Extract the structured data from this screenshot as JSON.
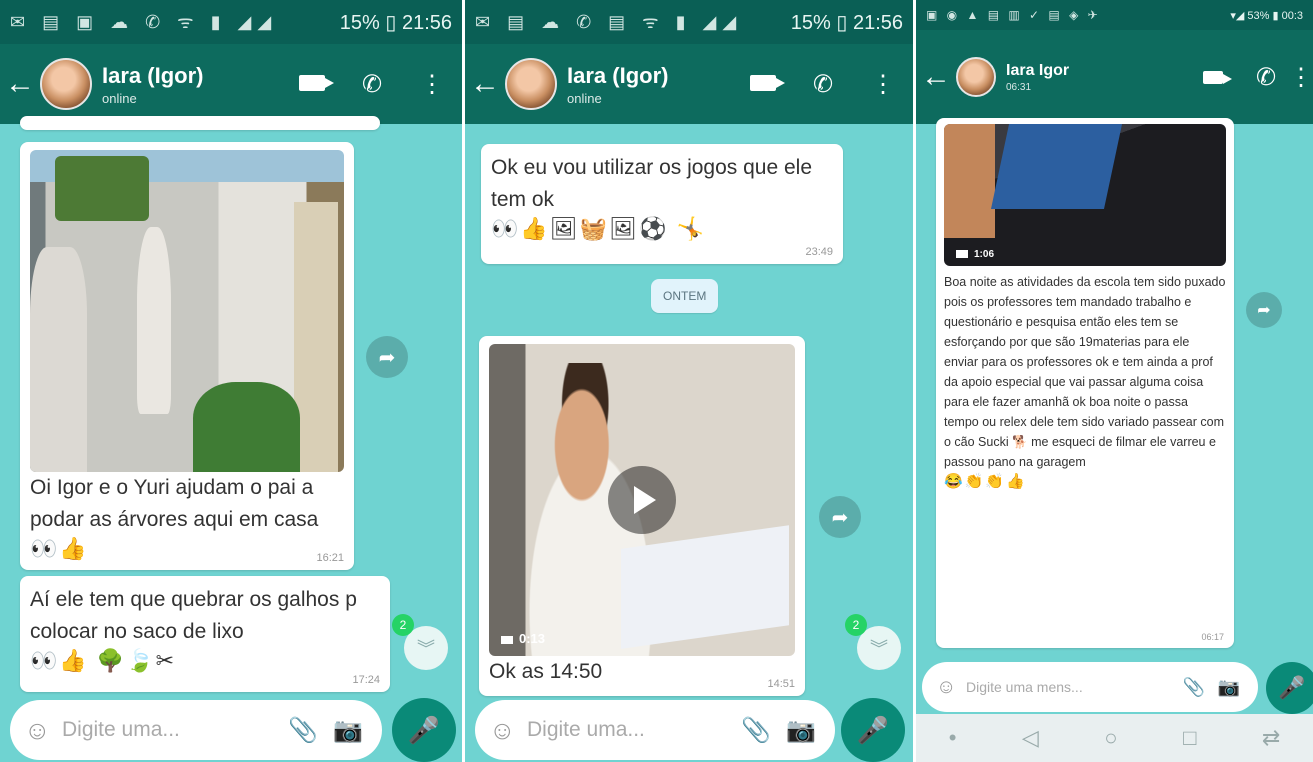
{
  "panels": [
    {
      "status": {
        "icons": "✉ ▤ ▣ ☁ ✆ ᯤ ▮ ◢◢",
        "right": "15% ▯ 21:56"
      },
      "header": {
        "back": "←",
        "name": "Iara (Igor)",
        "subtitle": "online"
      },
      "messages": [
        {
          "text": "Oi Igor e o Yuri ajudam o pai a podar as árvores aqui em casa",
          "emojis": "👀👍",
          "time": "16:21"
        },
        {
          "text": "Aí ele tem que quebrar os galhos p colocar no saco de lixo",
          "emojis": "👀👍 🌳🍃✂",
          "time": "17:24"
        }
      ],
      "badge": "2",
      "input_placeholder": "Digite uma..."
    },
    {
      "status": {
        "icons": "✉ ▤ ☁ ✆ ▤ ᯤ ▮ ◢◢",
        "right": "15% ▯ 21:56"
      },
      "header": {
        "back": "←",
        "name": "Iara (Igor)",
        "subtitle": "online"
      },
      "messages": [
        {
          "text": "Ok eu vou utilizar os jogos que ele tem ok",
          "emojis": "👀👍🖼🧺🖼⚽ 🤸",
          "time": "23:49"
        },
        {
          "text": "Ok as 14:50",
          "time": "14:51",
          "video_duration": "0:13"
        }
      ],
      "date_chip": "ONTEM",
      "badge": "2",
      "input_placeholder": "Digite uma..."
    },
    {
      "status": {
        "icons": "▣ ◉ ▲ ▤ ▥ ✓ ▤ ◈ ✈",
        "right": "▾◢ 53% ▮ 00:3"
      },
      "header": {
        "back": "←",
        "name": "Iara Igor",
        "subtitle": "06:31"
      },
      "messages": [
        {
          "text": "Boa noite as atividades da escola tem sido puxado pois os professores tem mandado trabalho e questionário e pesquisa então eles tem se esforçando por que são 19materias para ele enviar para os professores ok e tem ainda a prof da apoio especial que vai passar alguma coisa para ele fazer amanhã ok boa noite o passa tempo ou relex dele tem sido variado passear com o cão Sucki 🐕 me esqueci de filmar ele varreu e passou pano na garagem",
          "emojis": "😂👏👏👍",
          "time": "06:17",
          "video_duration": "1:06"
        }
      ],
      "input_placeholder": "Digite uma mens..."
    }
  ],
  "icons": {
    "back": "arrow-left-icon",
    "video": "video-call-icon",
    "call": "phone-icon",
    "menu": "more-vert-icon",
    "forward": "forward-icon",
    "emoji": "emoji-icon",
    "attach": "paperclip-icon",
    "camera": "camera-icon",
    "mic": "mic-icon"
  },
  "colors": {
    "appbar": "#0d6b5e",
    "statusbar": "#0a5f55",
    "chat_background": "#6fd3d1",
    "bubble": "#ffffff",
    "mic_button": "#0a8a78"
  }
}
